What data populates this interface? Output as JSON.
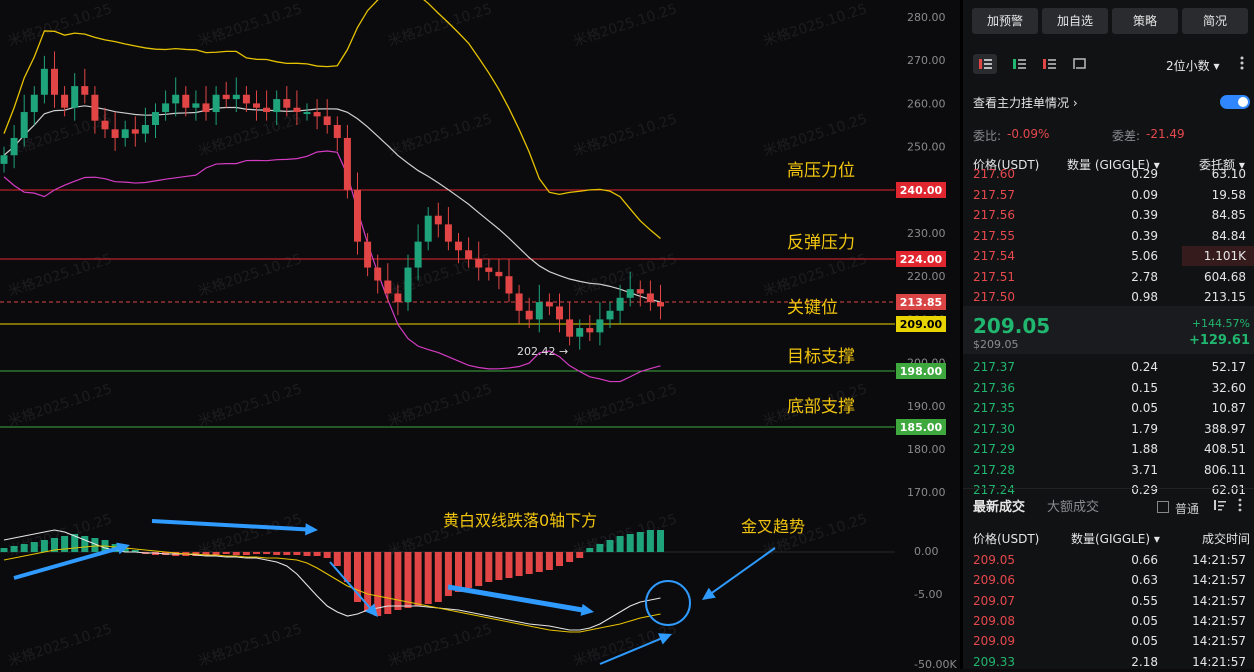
{
  "chart": {
    "price_axis": [
      "280.00",
      "270.00",
      "260.00",
      "250.00",
      "240.00",
      "230.00",
      "220.00",
      "210.00",
      "200.00",
      "190.00",
      "180.00",
      "170.00"
    ],
    "level_labels": [
      {
        "text": "240.00",
        "bg": "#e0262f",
        "fg": "#ffffff"
      },
      {
        "text": "224.00",
        "bg": "#e0262f",
        "fg": "#ffffff"
      },
      {
        "text": "213.85",
        "bg": "#d94545",
        "fg": "#ffffff"
      },
      {
        "text": "209.00",
        "bg": "#e8d400",
        "fg": "#000000"
      },
      {
        "text": "198.00",
        "bg": "#3ea83e",
        "fg": "#ffffff"
      },
      {
        "text": "185.00",
        "bg": "#3ea83e",
        "fg": "#ffffff"
      }
    ],
    "annotations": {
      "high_pressure": "高压力位",
      "rebound_pressure": "反弹压力",
      "key_level": "关键位",
      "target_support": "目标支撑",
      "bottom_support": "底部支撑",
      "macd_note": "黄白双线跌落0轴下方",
      "golden_cross": "金叉趋势",
      "low_marker": "202.42"
    },
    "macd_axis": [
      "0.00",
      "-5.00",
      "-50.00K"
    ],
    "watermark": "米格2025.10.25",
    "colors": {
      "up": "#1fa37a",
      "down": "#e14545",
      "boll_mid": "#cfcfcf",
      "boll_upper": "#e6c200",
      "boll_lower": "#d43cc3",
      "annotation": "#f1c40f",
      "arrow": "#2f9bff"
    }
  },
  "panel": {
    "buttons": [
      "加预警",
      "加自选",
      "策略",
      "简况"
    ],
    "decimals": "2位小数",
    "main_orders_label": "查看主力挂单情况",
    "ratio_label": "委比:",
    "ratio_value": "-0.09%",
    "diff_label": "委差:",
    "diff_value": "-21.49",
    "book_headers": {
      "price": "价格(USDT)",
      "qty": "数量 (GIGGLE)",
      "amount": "委托额"
    },
    "asks": [
      {
        "price": "217.60",
        "qty": "0.29",
        "amount": "63.10"
      },
      {
        "price": "217.57",
        "qty": "0.09",
        "amount": "19.58"
      },
      {
        "price": "217.56",
        "qty": "0.39",
        "amount": "84.85"
      },
      {
        "price": "217.55",
        "qty": "0.39",
        "amount": "84.84"
      },
      {
        "price": "217.54",
        "qty": "5.06",
        "amount": "1.101K"
      },
      {
        "price": "217.51",
        "qty": "2.78",
        "amount": "604.68"
      },
      {
        "price": "217.50",
        "qty": "0.98",
        "amount": "213.15"
      }
    ],
    "last_price": "209.05",
    "last_price_sub": "$209.05",
    "change_pct": "+144.57%",
    "change_abs": "+129.61",
    "bids": [
      {
        "price": "217.37",
        "qty": "0.24",
        "amount": "52.17"
      },
      {
        "price": "217.36",
        "qty": "0.15",
        "amount": "32.60"
      },
      {
        "price": "217.35",
        "qty": "0.05",
        "amount": "10.87"
      },
      {
        "price": "217.30",
        "qty": "1.79",
        "amount": "388.97"
      },
      {
        "price": "217.29",
        "qty": "1.88",
        "amount": "408.51"
      },
      {
        "price": "217.28",
        "qty": "3.71",
        "amount": "806.11"
      },
      {
        "price": "217.24",
        "qty": "0.29",
        "amount": "62.01"
      }
    ],
    "trades_tabs": [
      "最新成交",
      "大额成交"
    ],
    "ordinary_label": "普通",
    "trades_headers": {
      "price": "价格(USDT)",
      "qty": "数量(GIGGLE)",
      "time": "成交时间"
    },
    "trades": [
      {
        "price": "209.05",
        "qty": "0.66",
        "time": "14:21:57"
      },
      {
        "price": "209.06",
        "qty": "0.63",
        "time": "14:21:57"
      },
      {
        "price": "209.07",
        "qty": "0.55",
        "time": "14:21:57"
      },
      {
        "price": "209.08",
        "qty": "0.05",
        "time": "14:21:57"
      },
      {
        "price": "209.09",
        "qty": "0.05",
        "time": "14:21:57"
      },
      {
        "price": "209.33",
        "qty": "2.18",
        "time": "14:21:57"
      }
    ]
  }
}
